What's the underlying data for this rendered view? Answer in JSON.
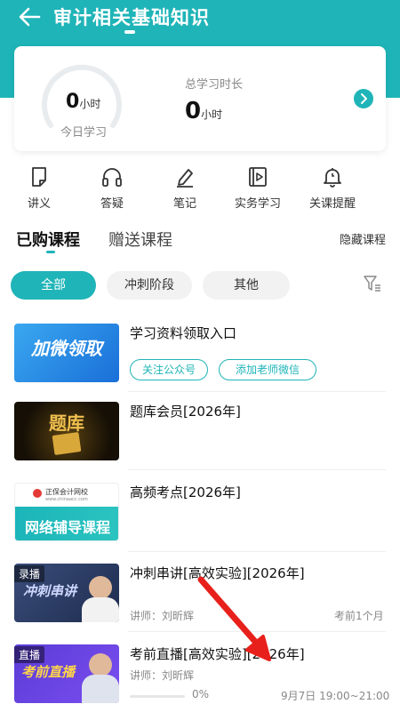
{
  "header": {
    "title": "审计相关基础知识"
  },
  "stats": {
    "today_value": "0",
    "today_unit": "小时",
    "today_label": "今日学习",
    "total_label": "总学习时长",
    "total_value": "0",
    "total_unit": "小时"
  },
  "tools": [
    {
      "label": "讲义",
      "icon": "handout-icon"
    },
    {
      "label": "答疑",
      "icon": "headphones-icon"
    },
    {
      "label": "笔记",
      "icon": "pen-icon"
    },
    {
      "label": "实务学习",
      "icon": "video-icon"
    },
    {
      "label": "关课提醒",
      "icon": "bell-icon"
    }
  ],
  "tabs": {
    "purchased": "已购课程",
    "gifted": "赠送课程",
    "hide": "隐藏课程"
  },
  "filters": [
    "全部",
    "冲刺阶段",
    "其他"
  ],
  "courses": [
    {
      "title": "学习资料领取入口",
      "thumb_text": "加微领取",
      "tags": [
        "关注公众号",
        "添加老师微信"
      ]
    },
    {
      "title": "题库会员[2026年]",
      "thumb_text": "题库"
    },
    {
      "title": "高频考点[2026年]",
      "thumb_brand": "正保会计网校",
      "thumb_site": "www.chinaacc.com",
      "thumb_text": "网络辅导课程"
    },
    {
      "title": "冲刺串讲[高效实验][2026年]",
      "badge": "录播",
      "thumb_text": "冲刺串讲",
      "teacher": "讲师：刘昕辉",
      "meta": "考前1个月"
    },
    {
      "title": "考前直播[高效实验][2026年]",
      "badge": "直播",
      "thumb_text": "考前直播",
      "teacher": "讲师：刘昕辉",
      "progress_percent": 0,
      "progress_label": "0%",
      "schedule": "9月7日 19:00~21:00"
    }
  ],
  "colors": {
    "accent": "#1fb4b8",
    "annotation_arrow": "#e8201b"
  }
}
